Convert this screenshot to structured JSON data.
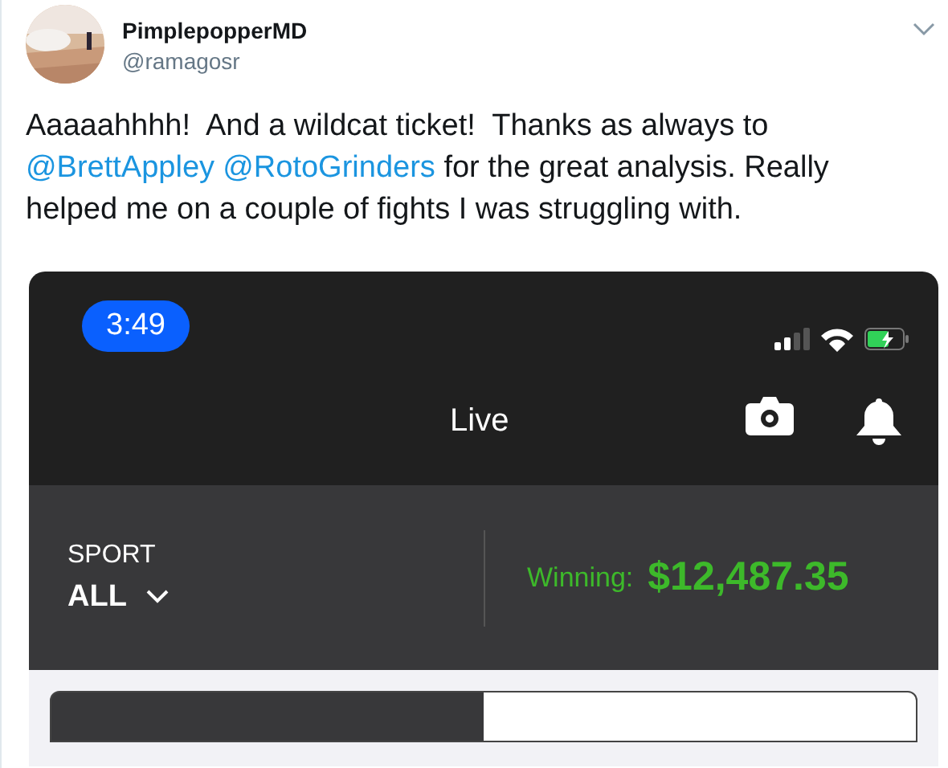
{
  "tweet": {
    "name": "PimplepopperMD",
    "handle": "@ramagosr",
    "text": [
      {
        "kind": "text",
        "text": "Aaaaahhhh!  And a wildcat ticket!  Thanks as always to "
      },
      {
        "kind": "mention",
        "text": "@BrettAppley"
      },
      {
        "kind": "mention",
        "text": "@RotoGrinders"
      },
      {
        "kind": "text",
        "text": " for the great analysis. Really helped me on a couple of fights I was struggling with."
      }
    ]
  },
  "phone": {
    "time": "3:49",
    "title": "Live",
    "sport_label": "SPORT",
    "sport_value": "ALL",
    "winning_label": "Winning:",
    "winning_amount": "$12,487.35"
  }
}
